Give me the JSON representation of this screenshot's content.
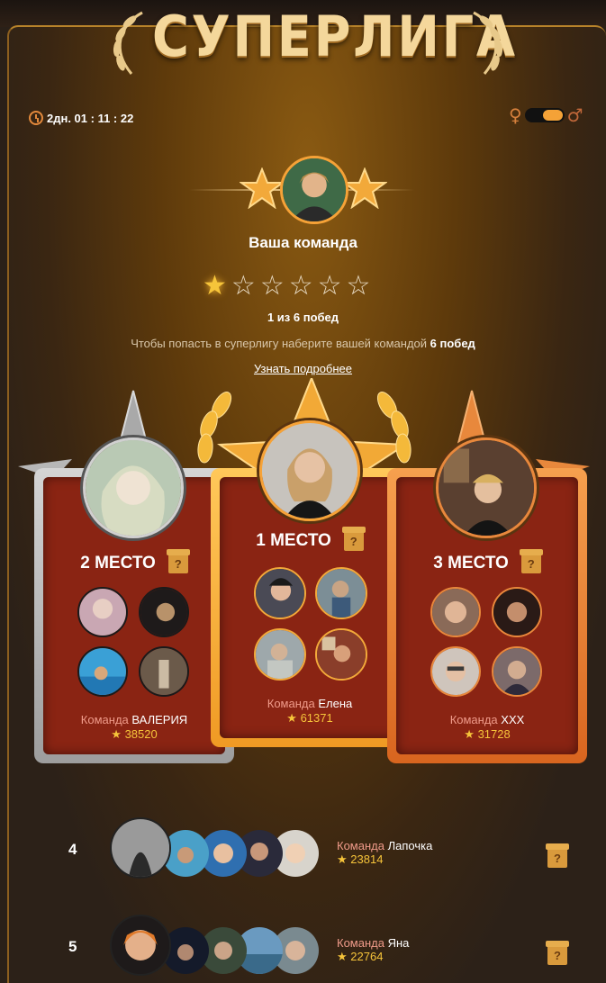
{
  "header": {
    "title": "СУПЕРЛИГА",
    "timer": "2дн. 01 : 11 : 22"
  },
  "gender": {
    "female_icon": "female-icon",
    "male_icon": "male-icon"
  },
  "your_team": {
    "label": "Ваша команда",
    "stars_earned": 1,
    "stars_total": 6,
    "wins_text": "1 из 6 побед",
    "hint_prefix": "Чтобы попасть в суперлигу наберите вашей командой ",
    "hint_bold": "6 побед",
    "more_link": "Узнать подробнее"
  },
  "podium": [
    {
      "place": "2 МЕСТО",
      "team_prefix": "Команда",
      "team": "ВАЛЕРИЯ",
      "score": "38520"
    },
    {
      "place": "1 МЕСТО",
      "team_prefix": "Команда",
      "team": "Елена",
      "score": "61371"
    },
    {
      "place": "3 МЕСТО",
      "team_prefix": "Команда",
      "team": "XXX",
      "score": "31728"
    }
  ],
  "list": [
    {
      "rank": "4",
      "team_prefix": "Команда",
      "team": "Лапочка",
      "score": "23814"
    },
    {
      "rank": "5",
      "team_prefix": "Команда",
      "team": "Яна",
      "score": "22764"
    }
  ],
  "colors": {
    "accent": "#f6a237",
    "card_red": "#8a2413",
    "gold": "#f6c43a"
  }
}
